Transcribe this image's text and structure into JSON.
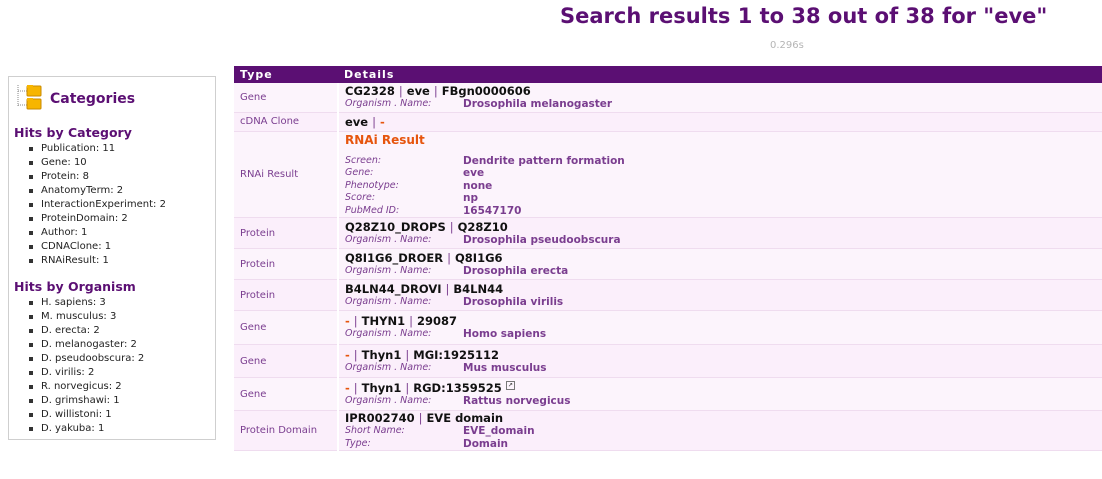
{
  "page": {
    "title": "Search results 1 to 38 out of 38 for \"eve\"",
    "timing": "0.296s"
  },
  "colors": {
    "accent": "#5b0f73",
    "link": "#7a3d8f",
    "dash": "#e6550d",
    "row_bg": "#fcf4fc"
  },
  "sidebar": {
    "icon": "folder-tree-icon",
    "title": "Categories",
    "hits_by_category_title": "Hits by Category",
    "hits_by_category": [
      "Publication: 11",
      "Gene: 10",
      "Protein: 8",
      "AnatomyTerm: 2",
      "InteractionExperiment: 2",
      "ProteinDomain: 2",
      "Author: 1",
      "CDNAClone: 1",
      "RNAiResult: 1"
    ],
    "hits_by_organism_title": "Hits by Organism",
    "hits_by_organism": [
      "H. sapiens: 3",
      "M. musculus: 3",
      "D. erecta: 2",
      "D. melanogaster: 2",
      "D. pseudoobscura: 2",
      "D. virilis: 2",
      "R. norvegicus: 2",
      "D. grimshawi: 1",
      "D. willistoni: 1",
      "D. yakuba: 1"
    ]
  },
  "table": {
    "headers": {
      "type": "Type",
      "details": "Details"
    },
    "rows": [
      {
        "type": "Gene",
        "ids": [
          "CG2328",
          "eve",
          "FBgn0000606"
        ],
        "fields": [
          {
            "label": "Organism . Name:",
            "value": "Drosophila melanogaster"
          }
        ]
      },
      {
        "type": "cDNA Clone",
        "ids": [
          "eve",
          "-"
        ],
        "fields": []
      },
      {
        "type": "RNAi Result",
        "heading": "RNAi Result",
        "fields": [
          {
            "label": "Screen:",
            "value": "Dendrite pattern formation"
          },
          {
            "label": "Gene:",
            "value": "eve"
          },
          {
            "label": "Phenotype:",
            "value": "none"
          },
          {
            "label": "Score:",
            "value": "np"
          },
          {
            "label": "PubMed ID:",
            "value": "16547170"
          }
        ]
      },
      {
        "type": "Protein",
        "ids": [
          "Q28Z10_DROPS",
          "Q28Z10"
        ],
        "fields": [
          {
            "label": "Organism . Name:",
            "value": "Drosophila pseudoobscura"
          }
        ]
      },
      {
        "type": "Protein",
        "ids": [
          "Q8I1G6_DROER",
          "Q8I1G6"
        ],
        "fields": [
          {
            "label": "Organism . Name:",
            "value": "Drosophila erecta"
          }
        ]
      },
      {
        "type": "Protein",
        "ids": [
          "B4LN44_DROVI",
          "B4LN44"
        ],
        "fields": [
          {
            "label": "Organism . Name:",
            "value": "Drosophila virilis"
          }
        ]
      },
      {
        "type": "Gene",
        "ids": [
          "-",
          "THYN1",
          "29087"
        ],
        "fields": [
          {
            "label": "Organism . Name:",
            "value": "Homo sapiens"
          }
        ]
      },
      {
        "type": "Gene",
        "ids": [
          "-",
          "Thyn1",
          "MGI:1925112"
        ],
        "fields": [
          {
            "label": "Organism . Name:",
            "value": "Mus musculus"
          }
        ]
      },
      {
        "type": "Gene",
        "ids": [
          "-",
          "Thyn1",
          "RGD:1359525"
        ],
        "external_link": true,
        "fields": [
          {
            "label": "Organism . Name:",
            "value": "Rattus norvegicus"
          }
        ]
      },
      {
        "type": "Protein Domain",
        "ids": [
          "IPR002740",
          "EVE domain"
        ],
        "fields": [
          {
            "label": "Short Name:",
            "value": "EVE_domain"
          },
          {
            "label": "Type:",
            "value": "Domain"
          }
        ]
      }
    ]
  }
}
